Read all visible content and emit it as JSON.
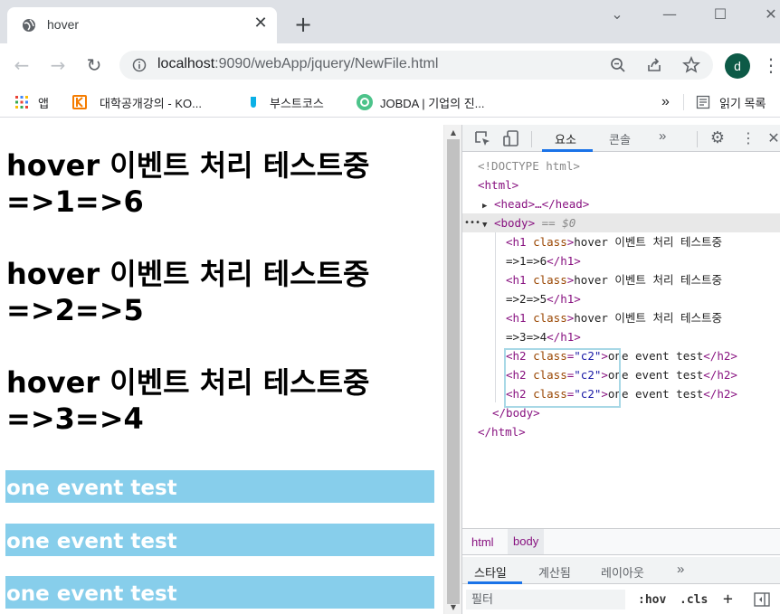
{
  "tab": {
    "title": "hover",
    "close": "✕"
  },
  "window": {
    "minimize": "—",
    "maximize": "☐",
    "close": "✕",
    "tabsearch": "⌄",
    "newtab": "+"
  },
  "toolbar": {
    "url_host": "localhost",
    "url_rest": ":9090/webApp/jquery/NewFile.html",
    "avatar": "d"
  },
  "bookmarks": {
    "items": [
      {
        "label": "앱"
      },
      {
        "label": "대학공개강의 - KO..."
      },
      {
        "label": "부스트코스"
      },
      {
        "label": "JOBDA | 기업의 진..."
      }
    ],
    "overflow": "»",
    "reading_list": "읽기 목록"
  },
  "page": {
    "h1": [
      {
        "line1": "hover 이벤트 처리 테스트중",
        "line2": "=>1=>6"
      },
      {
        "line1": "hover 이벤트 처리 테스트중",
        "line2": "=>2=>5"
      },
      {
        "line1": "hover 이벤트 처리 테스트중",
        "line2": "=>3=>4"
      }
    ],
    "h2": [
      "one event test",
      "one event test",
      "one event test"
    ]
  },
  "devtools": {
    "tabs": {
      "elements": "요소",
      "console": "콘솔",
      "more": "»"
    },
    "dom": {
      "doctype": "<!DOCTYPE html>",
      "html_open": "<html>",
      "head": "<head>…</head>",
      "body_open": "<body>",
      "body_sel": "== $0",
      "dots": "•••",
      "h1_rows": [
        {
          "text": "hover 이벤트 처리 테스트중",
          "cont": "=>1=>6"
        },
        {
          "text": "hover 이벤트 처리 테스트중",
          "cont": "=>2=>5"
        },
        {
          "text": "hover 이벤트 처리 테스트중",
          "cont": "=>3=>4"
        }
      ],
      "h2_text": "one event test",
      "h2_class": "\"c2\"",
      "body_close": "</body>",
      "html_close": "</html>"
    },
    "crumbs": [
      "html",
      "body"
    ],
    "style_tabs": {
      "styles": "스타일",
      "computed": "계산됨",
      "layout": "레이아웃",
      "more": "»"
    },
    "filter": {
      "placeholder": "필터",
      "hov": ":hov",
      "cls": ".cls"
    }
  },
  "colors": {
    "h2_bg": "#87ceeb",
    "tag": "#881280",
    "attr": "#994500",
    "value": "#1a1aa6",
    "accent": "#1a73e8"
  }
}
